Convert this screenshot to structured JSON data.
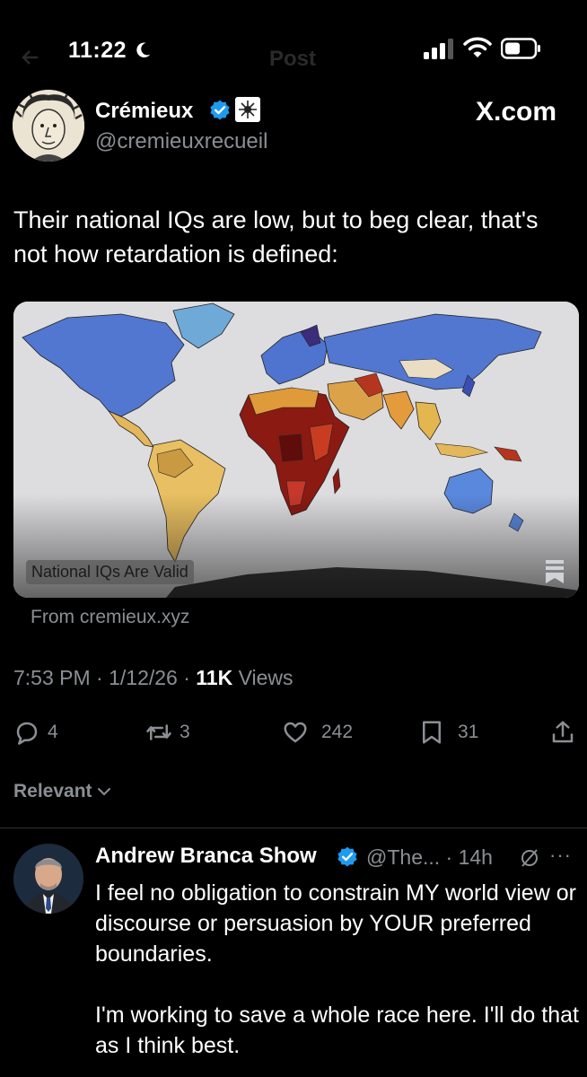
{
  "status_bar": {
    "time": "11:22",
    "ghost_title": "Post"
  },
  "post": {
    "author_name": "Crémieux",
    "author_handle": "@cremieuxrecueil",
    "watermark": "X.com",
    "text": "Their national IQs are low, but to beg clear, that's not how retardation is defined:",
    "card": {
      "caption": "National IQs Are Valid",
      "source": "From cremieux.xyz"
    },
    "meta": {
      "datetime": "7:53 PM · 1/12/26 · ",
      "views_count": "11K",
      "views_label": " Views"
    },
    "actions": {
      "replies": "4",
      "reposts": "3",
      "likes": "242",
      "bookmarks": "31"
    }
  },
  "sort": {
    "label": "Relevant"
  },
  "reply": {
    "name": "Andrew Branca Show",
    "handle_time": "@The... · 14h",
    "more": "···",
    "text": "I feel no obligation to constrain MY world view or discourse or persuasion by YOUR preferred boundaries.\n\nI'm working to save a whole race here. I'll do that as I think best."
  },
  "colors": {
    "background": "#000000",
    "text_primary": "#e7e9ea",
    "text_secondary": "#8b8f94",
    "verified": "#1d9bf0",
    "divider": "#2f3336"
  }
}
